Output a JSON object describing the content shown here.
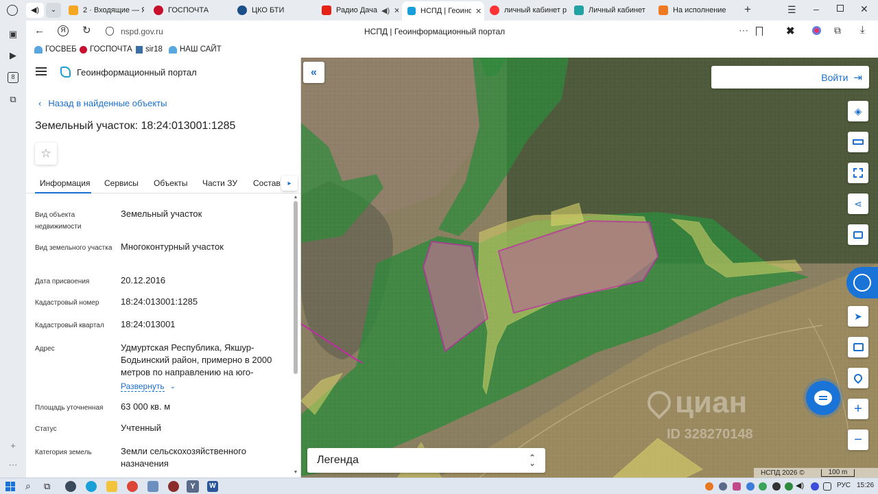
{
  "browser": {
    "tabs": [
      {
        "label": "2 · Входящие — Я"
      },
      {
        "label": "ГОСПОЧТА"
      },
      {
        "label": "ЦКО БТИ"
      },
      {
        "label": "Радио Дача"
      },
      {
        "label": "НСПД | Геоинф"
      },
      {
        "label": "личный кабинет р"
      },
      {
        "label": "Личный кабинет"
      },
      {
        "label": "На исполнение"
      }
    ],
    "url": "nspd.gov.ru",
    "page_title": "НСПД | Геоинформационный портал",
    "bookmarks": [
      "ГОСВЕБ",
      "ГОСПОЧТА",
      "sir18",
      "НАШ САЙТ"
    ]
  },
  "portal": {
    "name": "Геоинформационный портал",
    "back_link": "Назад в найденные объекты",
    "title": "Земельный участок: 18:24:013001:1285",
    "tabs": [
      "Информация",
      "Сервисы",
      "Объекты",
      "Части ЗУ",
      "Состав"
    ],
    "rows": [
      {
        "label": "Вид объекта недвижимости",
        "value": "Земельный участок"
      },
      {
        "label": "Вид земельного участка",
        "value": "Многоконтурный участок"
      },
      {
        "label": "Дата присвоения",
        "value": "20.12.2016"
      },
      {
        "label": "Кадастровый номер",
        "value": "18:24:013001:1285"
      },
      {
        "label": "Кадастровый квартал",
        "value": "18:24:013001"
      },
      {
        "label": "Адрес",
        "value": "Удмуртская Республика, Якшур-Бодьинский район, примерно в 2000 метров по направлению на юго-"
      },
      {
        "label": "Площадь уточненная",
        "value": "63 000 кв. м"
      },
      {
        "label": "Статус",
        "value": "Учтенный"
      },
      {
        "label": "Категория земель",
        "value": "Земли сельскохозяйственного назначения"
      }
    ],
    "expand_link": "Развернуть"
  },
  "map": {
    "login_label": "Войти",
    "legend_label": "Легенда",
    "copyright": "НСПД 2026 ©",
    "scale": "100 m",
    "watermark_text": "циан",
    "watermark_id": "ID 328270148"
  },
  "taskbar": {
    "lang": "РУС",
    "time": "15:26"
  },
  "colors": {
    "accent": "#1a6fd0",
    "forest_overlay": "#2e8a3c",
    "parcel_fill": "#d9d36a",
    "parcel_selected": "#c02aa6"
  }
}
